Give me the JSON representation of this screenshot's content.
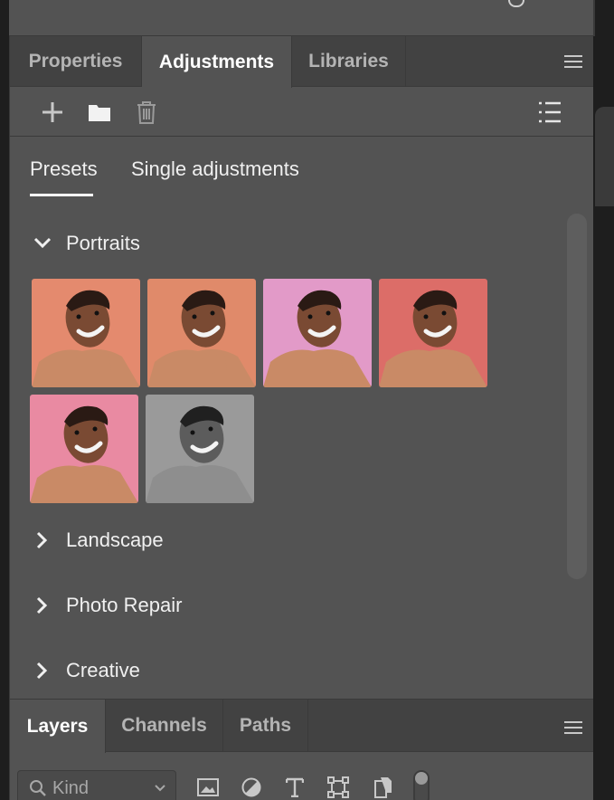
{
  "properties_panel": {
    "tabs": [
      {
        "label": "Properties",
        "active": false
      },
      {
        "label": "Adjustments",
        "active": true
      },
      {
        "label": "Libraries",
        "active": false
      }
    ],
    "toolbar": {
      "icons": [
        "plus-icon",
        "folder-icon",
        "trash-icon",
        "list-view-icon"
      ]
    },
    "subtabs": [
      {
        "label": "Presets",
        "active": true
      },
      {
        "label": "Single adjustments",
        "active": false
      }
    ],
    "sections": [
      {
        "label": "Portraits",
        "expanded": true,
        "preset_count": 6
      },
      {
        "label": "Landscape",
        "expanded": false
      },
      {
        "label": "Photo Repair",
        "expanded": false
      },
      {
        "label": "Creative",
        "expanded": false
      }
    ],
    "presets": [
      {
        "name": "portrait-preset-1",
        "tint": "#e48a6e"
      },
      {
        "name": "portrait-preset-2",
        "tint": "#e08a6a"
      },
      {
        "name": "portrait-preset-3",
        "tint": "#e29ac8"
      },
      {
        "name": "portrait-preset-4",
        "tint": "#dc6d68"
      },
      {
        "name": "portrait-preset-5",
        "tint": "#e98aa2"
      },
      {
        "name": "portrait-preset-6",
        "tint": "#9a9a9a"
      }
    ]
  },
  "layers_panel": {
    "tabs": [
      {
        "label": "Layers",
        "active": true
      },
      {
        "label": "Channels",
        "active": false
      },
      {
        "label": "Paths",
        "active": false
      }
    ],
    "filter": {
      "placeholder": "Kind"
    },
    "filter_icons": [
      "image-filter-icon",
      "adjustment-filter-icon",
      "type-filter-icon",
      "shape-filter-icon",
      "smart-object-filter-icon",
      "filter-toggle-icon"
    ]
  },
  "colors": {
    "panel_bg": "#535353",
    "tab_bar_bg": "#424242",
    "text": "#f0f0f0",
    "muted_text": "#b4b4b4"
  }
}
